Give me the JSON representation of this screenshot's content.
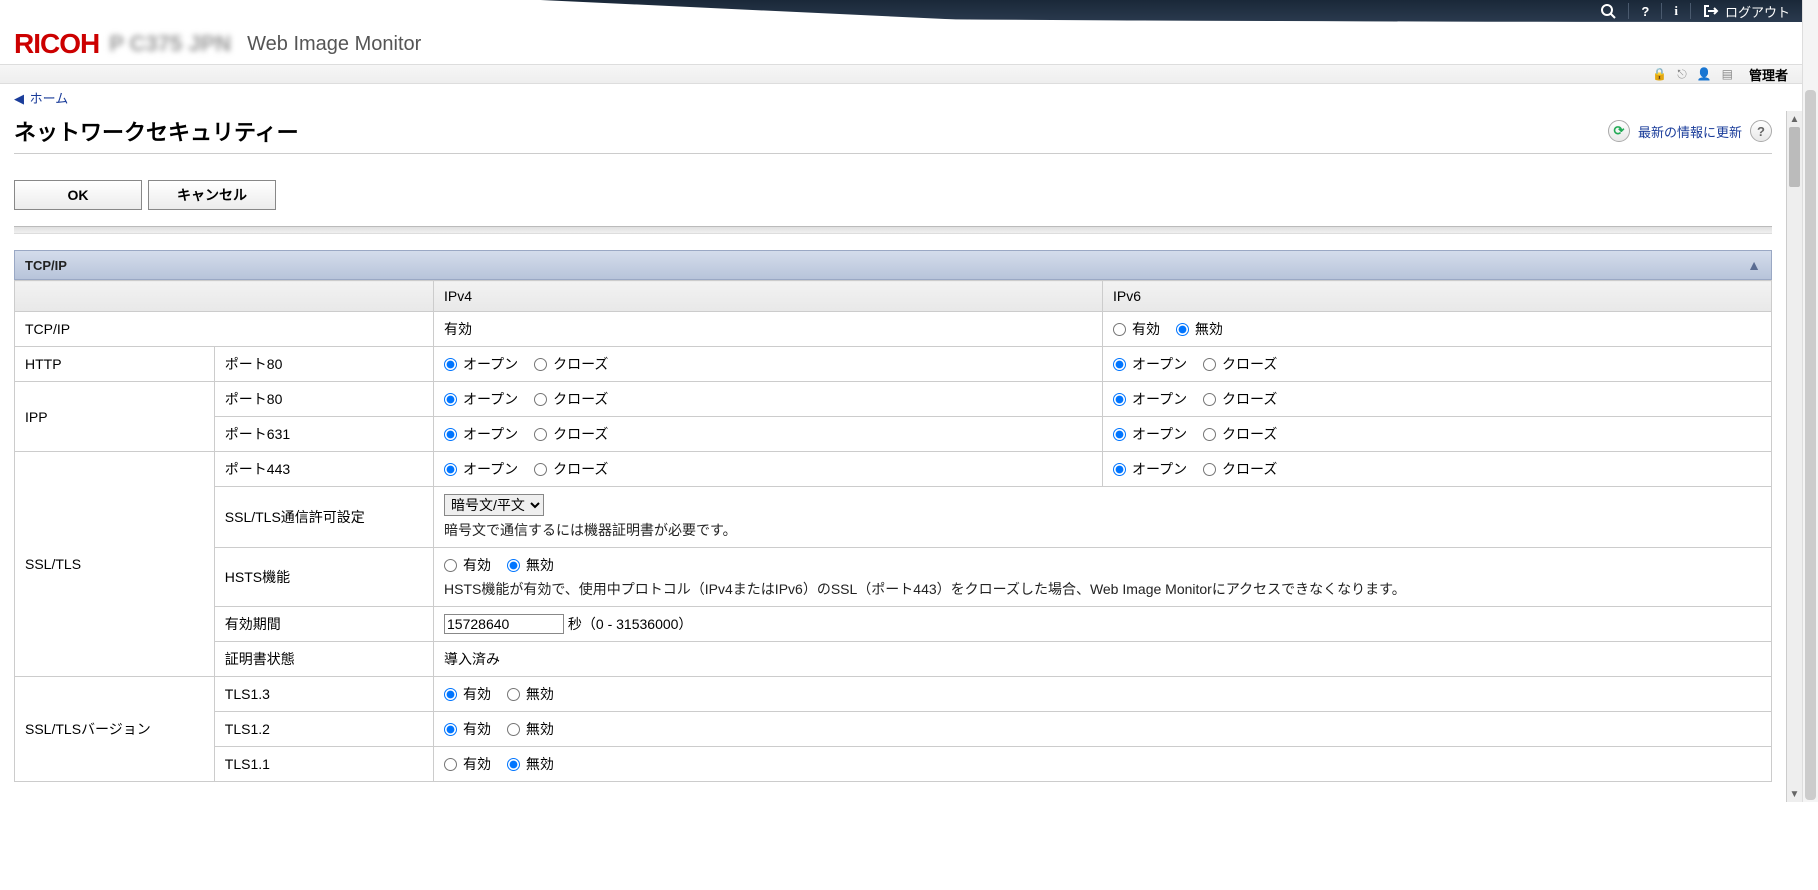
{
  "topbar": {
    "logout_label": "ログアウト"
  },
  "branding": {
    "logo": "RICOH",
    "model": "P C375 JPN",
    "app": "Web Image Monitor"
  },
  "subheader": {
    "admin_label": "管理者"
  },
  "breadcrumb": {
    "home": "ホーム"
  },
  "page": {
    "title": "ネットワークセキュリティー",
    "refresh_label": "最新の情報に更新"
  },
  "buttons": {
    "ok": "OK",
    "cancel": "キャンセル"
  },
  "section": {
    "tcpip_title": "TCP/IP"
  },
  "table": {
    "col_ipv4": "IPv4",
    "col_ipv6": "IPv6",
    "labels": {
      "tcpip": "TCP/IP",
      "http": "HTTP",
      "ipp": "IPP",
      "ssltls": "SSL/TLS",
      "port80": "ポート80",
      "port631": "ポート631",
      "port443": "ポート443",
      "ssl_perm": "SSL/TLS通信許可設定",
      "hsts": "HSTS機能",
      "valid_period": "有効期間",
      "cert_state": "証明書状態",
      "ssltls_ver": "SSL/TLSバージョン",
      "tls13": "TLS1.3",
      "tls12": "TLS1.2",
      "tls11": "TLS1.1"
    },
    "values": {
      "enabled": "有効",
      "disabled": "無効",
      "open": "オープン",
      "close": "クローズ",
      "ssl_mode": "暗号文/平文",
      "ssl_note": "暗号文で通信するには機器証明書が必要です。",
      "hsts_note": "HSTS機能が有効で、使用中プロトコル（IPv4またはIPv6）のSSL（ポート443）をクローズした場合、Web Image Monitorにアクセスできなくなります。",
      "period_value": "15728640",
      "period_suffix": "秒（0 - 31536000）",
      "cert_installed": "導入済み"
    }
  }
}
